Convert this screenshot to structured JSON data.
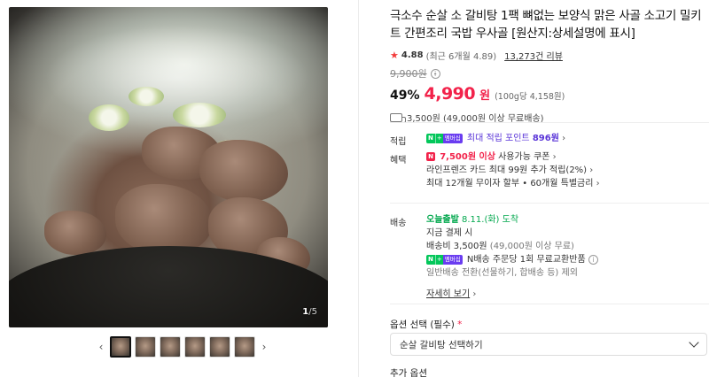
{
  "gallery": {
    "counter_current": "1",
    "counter_sep": "/",
    "counter_total": "5",
    "thumb_count": 6,
    "active_thumb": 0
  },
  "product": {
    "title": "극소수 순살 소 갈비탕 1팩 뼈없는 보양식 맑은 사골 소고기 밀키트 간편조리 국밥 우사골 [원산지:상세설명에 표시]",
    "rating_score": "4.88",
    "rating_sub": "(최근 6개월 4.89)",
    "review_count": "13,273건 리뷰",
    "original_price": "9,900원",
    "discount": "49%",
    "price": "4,990",
    "price_unit": "원",
    "unit_price": "(100g당 4,158원)",
    "shipping_summary": "3,500원 (49,000원 이상 무료배송)"
  },
  "points": {
    "label": "적립",
    "text": "최대 적립 포인트",
    "amount": "896원"
  },
  "benefits": {
    "label": "혜택",
    "coupon_amount": "7,500원 이상",
    "coupon_text": "사용가능 쿠폰",
    "line2": "라인프렌즈 카드 최대 99원 추가 적립(2%)",
    "line3": "최대 12개월 무이자 할부 • 60개월 특별금리"
  },
  "delivery": {
    "label": "배송",
    "today_brand": "오늘출발",
    "date": "8.11.(화) 도착",
    "pay_now": "지금 결제 시",
    "fee": "배송비 3,500원",
    "fee_note": "(49,000원 이상 무료)",
    "npay_text": "N배송 주문당 1회 무료교환반품",
    "general": "일반배송 전환(선물하기, 합배송 등) 제외",
    "detail_link": "자세히 보기"
  },
  "badges": {
    "n": "N",
    "plus": "+",
    "membership": "멤버십"
  },
  "options": {
    "label": "옵션 선택 (필수)",
    "required_mark": "*",
    "select_value": "순살 갈비탕 선택하기",
    "extra_label": "추가 옵션"
  }
}
